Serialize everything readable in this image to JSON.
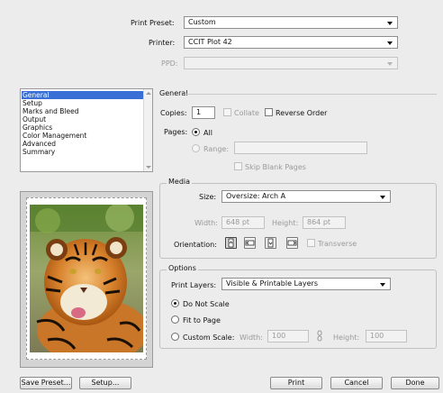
{
  "header": {
    "print_preset_label": "Print Preset:",
    "print_preset_value": "Custom",
    "printer_label": "Printer:",
    "printer_value": "CCIT Plot 42",
    "ppd_label": "PPD:",
    "ppd_value": ""
  },
  "sidebar": {
    "items": [
      {
        "label": "General"
      },
      {
        "label": "Setup"
      },
      {
        "label": "Marks and Bleed"
      },
      {
        "label": "Output"
      },
      {
        "label": "Graphics"
      },
      {
        "label": "Color Management"
      },
      {
        "label": "Advanced"
      },
      {
        "label": "Summary"
      }
    ],
    "selected_index": 0
  },
  "general": {
    "section_title": "General",
    "copies_label": "Copies:",
    "copies_value": "1",
    "collate_label": "Collate",
    "reverse_order_label": "Reverse Order",
    "pages_label": "Pages:",
    "all_label": "All",
    "range_label": "Range:",
    "range_value": "",
    "skip_blank_label": "Skip Blank Pages"
  },
  "media": {
    "section_title": "Media",
    "size_label": "Size:",
    "size_value": "Oversize: Arch A",
    "width_label": "Width:",
    "width_value": "648 pt",
    "height_label": "Height:",
    "height_value": "864 pt",
    "orientation_label": "Orientation:",
    "transverse_label": "Transverse"
  },
  "options": {
    "section_title": "Options",
    "print_layers_label": "Print Layers:",
    "print_layers_value": "Visible & Printable Layers",
    "do_not_scale_label": "Do Not Scale",
    "fit_to_page_label": "Fit to Page",
    "custom_scale_label": "Custom Scale:",
    "scale_width_label": "Width:",
    "scale_width_value": "100",
    "scale_height_label": "Height:",
    "scale_height_value": "100"
  },
  "footer": {
    "save_preset_label": "Save Preset...",
    "setup_label": "Setup...",
    "print_label": "Print",
    "cancel_label": "Cancel",
    "done_label": "Done"
  },
  "colors": {
    "selection": "#3a6fd6",
    "dialog_bg": "#ececec"
  }
}
